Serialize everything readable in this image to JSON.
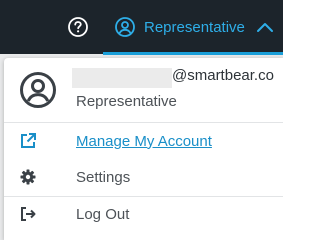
{
  "header": {
    "help_icon": "question-circle-icon",
    "user_button": {
      "label": "Representative",
      "icon": "user-circle-icon",
      "chevron_icon": "chevron-up-icon"
    },
    "accent_color": "#2eaee8",
    "background_color": "#1c242b"
  },
  "profile": {
    "avatar_icon": "user-circle-icon",
    "email_domain": "@smartbear.co",
    "role": "Representative"
  },
  "menu": {
    "items": [
      {
        "label": "Manage My Account",
        "icon": "external-link-icon",
        "style": "link"
      },
      {
        "label": "Settings",
        "icon": "gear-icon",
        "style": "normal"
      },
      {
        "label": "Log Out",
        "icon": "sign-out-icon",
        "style": "normal"
      }
    ]
  }
}
